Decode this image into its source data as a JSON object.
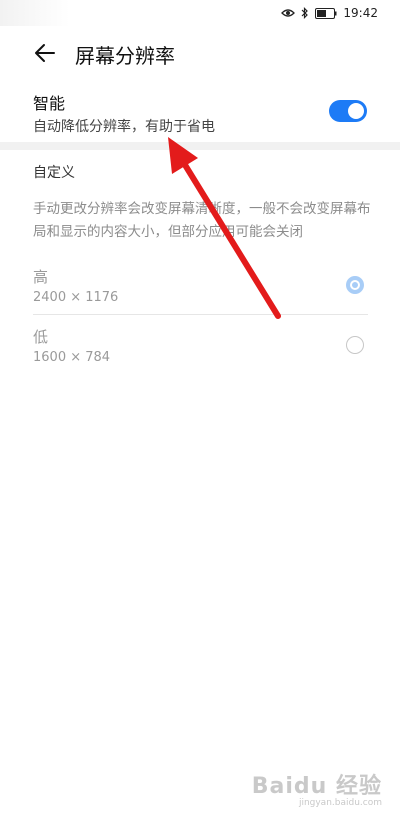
{
  "status_bar": {
    "time": "19:42",
    "icons": [
      "eye-icon",
      "bluetooth-icon",
      "battery-icon"
    ]
  },
  "header": {
    "title": "屏幕分辨率",
    "back_icon": "arrow-left-icon"
  },
  "smart_setting": {
    "title": "智能",
    "subtitle": "自动降低分辨率，有助于省电",
    "enabled": true,
    "accent_color": "#1d7bf6"
  },
  "custom_section": {
    "title": "自定义",
    "description": "手动更改分辨率会改变屏幕清晰度，一般不会改变屏幕布局和显示的内容大小，但部分应用可能会关闭",
    "options": [
      {
        "label": "高",
        "value": "2400 × 1176",
        "selected": true
      },
      {
        "label": "低",
        "value": "1600 × 784",
        "selected": false
      }
    ]
  },
  "watermark": {
    "logo": "Baidu 经验",
    "url": "jingyan.baidu.com"
  }
}
